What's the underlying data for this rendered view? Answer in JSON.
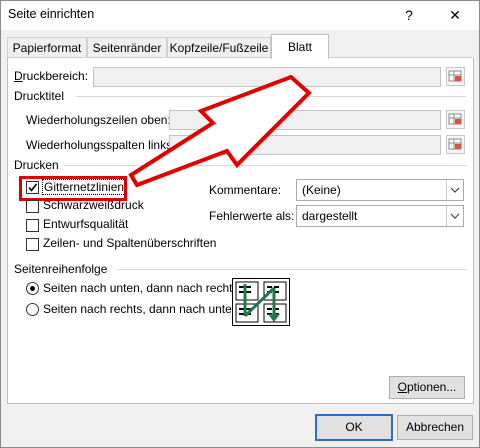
{
  "window": {
    "title": "Seite einrichten",
    "help_glyph": "?",
    "close_glyph": "✕"
  },
  "tabs": [
    {
      "label": "Papierformat"
    },
    {
      "label": "Seitenränder"
    },
    {
      "label": "Kopfzeile/Fußzeile"
    },
    {
      "label": "Blatt",
      "active": true
    }
  ],
  "print_area": {
    "label": "Druckbereich:",
    "value": ""
  },
  "print_titles": {
    "group_label": "Drucktitel",
    "rows_label": "Wiederholungszeilen oben:",
    "rows_value": "",
    "cols_label": "Wiederholungsspalten links:",
    "cols_value": ""
  },
  "print": {
    "group_label": "Drucken",
    "gridlines": {
      "label": "Gitternetzlinien",
      "checked": true
    },
    "black_white": {
      "label": "Schwarzweißdruck",
      "checked": false
    },
    "draft": {
      "label": "Entwurfsqualität",
      "checked": false
    },
    "headings": {
      "label": "Zeilen- und Spaltenüberschriften",
      "checked": false
    },
    "comments_label": "Kommentare:",
    "comments_value": "(Keine)",
    "errors_label": "Fehlerwerte als:",
    "errors_value": "dargestellt"
  },
  "page_order": {
    "group_label": "Seitenreihenfolge",
    "down_then_over": {
      "label": "Seiten nach unten, dann nach rechts",
      "selected": true
    },
    "over_then_down": {
      "label": "Seiten nach rechts, dann nach unten",
      "selected": false
    }
  },
  "buttons": {
    "options": "Optionen...",
    "ok": "OK",
    "cancel": "Abbrechen"
  },
  "annotation_colors": {
    "highlight": "#e00000",
    "arrow_fill": "#ffffff",
    "accent_green": "#1f7a4a",
    "focus_blue": "#2f6cc8"
  }
}
